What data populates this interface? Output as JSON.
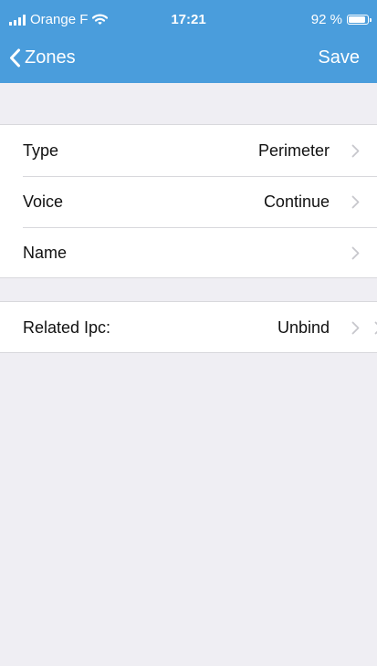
{
  "status_bar": {
    "carrier": "Orange F",
    "time": "17:21",
    "battery_percent": "92 %",
    "battery_level": 0.92,
    "signal_icon": "cellular-signal-icon",
    "wifi_icon": "wifi-icon",
    "battery_icon": "battery-icon"
  },
  "nav": {
    "back_label": "Zones",
    "back_icon": "chevron-left-icon",
    "save_label": "Save"
  },
  "settings": {
    "rows": [
      {
        "label": "Type",
        "value": "Perimeter"
      },
      {
        "label": "Voice",
        "value": "Continue"
      },
      {
        "label": "Name",
        "value": ""
      }
    ]
  },
  "related": {
    "label": "Related Ipc:",
    "value": "Unbind"
  },
  "colors": {
    "header_background": "#4A9DDC",
    "page_background": "#EFEEF3",
    "cell_background": "#FFFFFF",
    "chevron": "#C7C7CC",
    "separator": "#D8D8DC"
  }
}
